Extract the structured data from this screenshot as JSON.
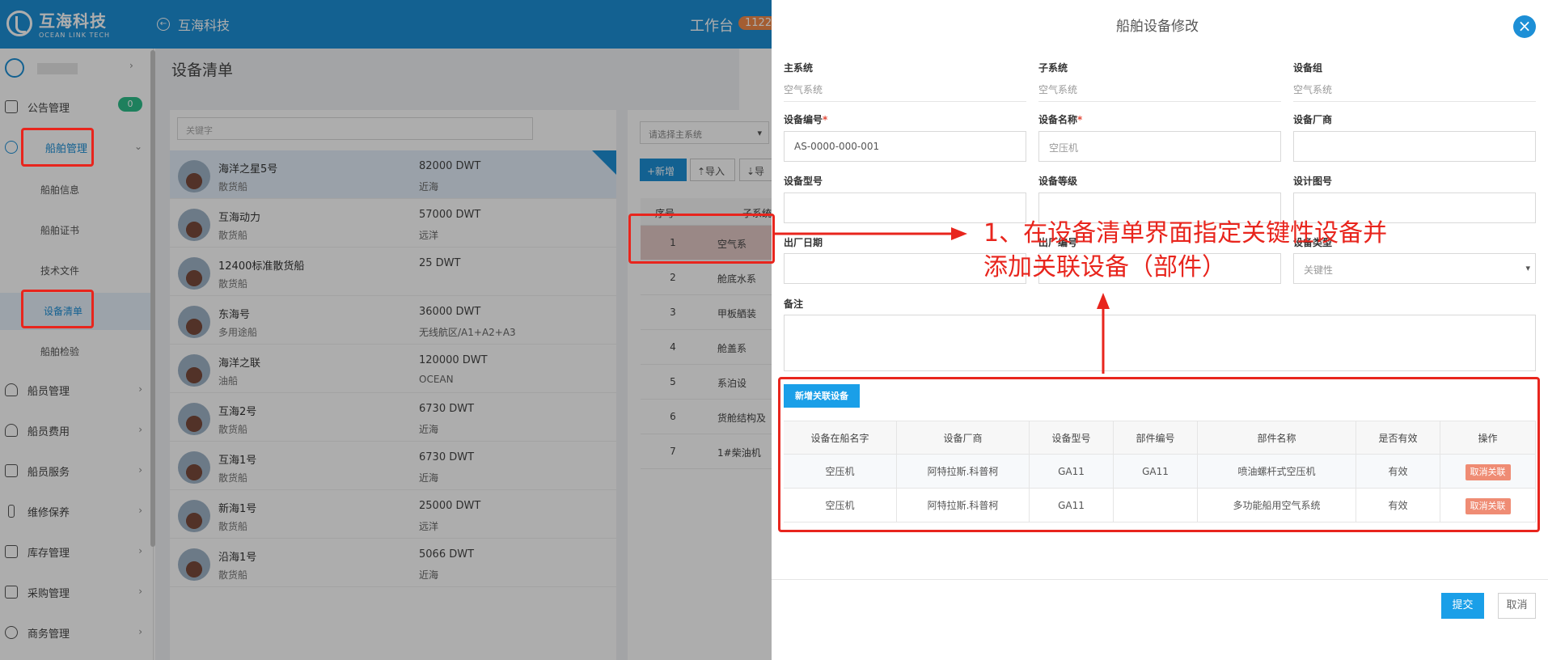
{
  "header": {
    "logo_title": "互海科技",
    "logo_sub": "OCEAN LINK TECH",
    "back_label": "互海科技",
    "workbench": "工作台",
    "workbench_count": "1122"
  },
  "sidebar": {
    "user": "",
    "notice_badge": "0",
    "items": [
      {
        "label": "公告管理",
        "icon": "book-icon"
      },
      {
        "label": "船舶管理",
        "icon": "anchor-icon"
      },
      {
        "label": "船员管理",
        "icon": "user-icon"
      },
      {
        "label": "船员费用",
        "icon": "user-icon"
      },
      {
        "label": "船员服务",
        "icon": "monitor-icon"
      },
      {
        "label": "维修保养",
        "icon": "wrench-icon"
      },
      {
        "label": "库存管理",
        "icon": "box-icon"
      },
      {
        "label": "采购管理",
        "icon": "cart-icon"
      },
      {
        "label": "商务管理",
        "icon": "globe-icon"
      }
    ],
    "subitems": [
      "船舶信息",
      "船舶证书",
      "技术文件",
      "设备清单",
      "船舶检验"
    ]
  },
  "page": {
    "title": "设备清单",
    "search_placeholder": "关键字",
    "system_select": "请选择主系统",
    "toolbar": {
      "new": "+新增",
      "import": "⇡导入",
      "export": "⇣导"
    }
  },
  "ships": [
    {
      "name": "海洋之星5号",
      "type": "散货船",
      "dwt": "82000 DWT",
      "area": "近海"
    },
    {
      "name": "互海动力",
      "type": "散货船",
      "dwt": "57000 DWT",
      "area": "远洋"
    },
    {
      "name": "12400标准散货船",
      "type": "散货船",
      "dwt": "25 DWT",
      "area": ""
    },
    {
      "name": "东海号",
      "type": "多用途船",
      "dwt": "36000 DWT",
      "area": "无线航区/A1+A2+A3"
    },
    {
      "name": "海洋之联",
      "type": "油船",
      "dwt": "120000 DWT",
      "area": "OCEAN"
    },
    {
      "name": "互海2号",
      "type": "散货船",
      "dwt": "6730 DWT",
      "area": "近海"
    },
    {
      "name": "互海1号",
      "type": "散货船",
      "dwt": "6730 DWT",
      "area": "近海"
    },
    {
      "name": "新海1号",
      "type": "散货船",
      "dwt": "25000 DWT",
      "area": "远洋"
    },
    {
      "name": "沿海1号",
      "type": "散货船",
      "dwt": "5066 DWT",
      "area": "近海"
    }
  ],
  "equip_table": {
    "headers": [
      "序号",
      "子系统"
    ],
    "rows": [
      {
        "no": "1",
        "name": "空气系"
      },
      {
        "no": "2",
        "name": "舱底水系"
      },
      {
        "no": "3",
        "name": "甲板舾装"
      },
      {
        "no": "4",
        "name": "舱盖系"
      },
      {
        "no": "5",
        "name": "系泊设"
      },
      {
        "no": "6",
        "name": "货舱结构及"
      },
      {
        "no": "7",
        "name": "1#柴油机"
      }
    ]
  },
  "modal": {
    "title": "船舶设备修改",
    "fields": {
      "main_system": {
        "label": "主系统",
        "value": "空气系统"
      },
      "sub_system": {
        "label": "子系统",
        "value": "空气系统"
      },
      "equip_group": {
        "label": "设备组",
        "value": "空气系统"
      },
      "equip_code": {
        "label": "设备编号",
        "value": "AS-0000-000-001"
      },
      "equip_name": {
        "label": "设备名称",
        "value": "空压机"
      },
      "manufacturer": {
        "label": "设备厂商",
        "value": ""
      },
      "model": {
        "label": "设备型号",
        "value": ""
      },
      "grade": {
        "label": "设备等级",
        "value": ""
      },
      "design_no": {
        "label": "设计图号",
        "value": ""
      },
      "factory_date": {
        "label": "出厂日期",
        "value": ""
      },
      "factory_no": {
        "label": "出厂编号",
        "value": ""
      },
      "equip_type": {
        "label": "设备类型",
        "value": "关键性"
      },
      "remark": {
        "label": "备注",
        "value": ""
      }
    },
    "add_related": "新增关联设备",
    "related": {
      "headers": [
        "设备在船名字",
        "设备厂商",
        "设备型号",
        "部件编号",
        "部件名称",
        "是否有效",
        "操作"
      ],
      "rows": [
        {
          "ship_name": "空压机",
          "maker": "阿特拉斯.科普柯",
          "model": "GA11",
          "part_no": "GA11",
          "part_name": "喷油螺杆式空压机",
          "valid": "有效",
          "action": "取消关联"
        },
        {
          "ship_name": "空压机",
          "maker": "阿特拉斯.科普柯",
          "model": "GA11",
          "part_no": "",
          "part_name": "多功能船用空气系统",
          "valid": "有效",
          "action": "取消关联"
        }
      ]
    },
    "submit": "提交",
    "cancel": "取消"
  },
  "annotation": {
    "line1": "1、在设备清单界面指定关键性设备并",
    "line2": "添加关联设备（部件）"
  }
}
